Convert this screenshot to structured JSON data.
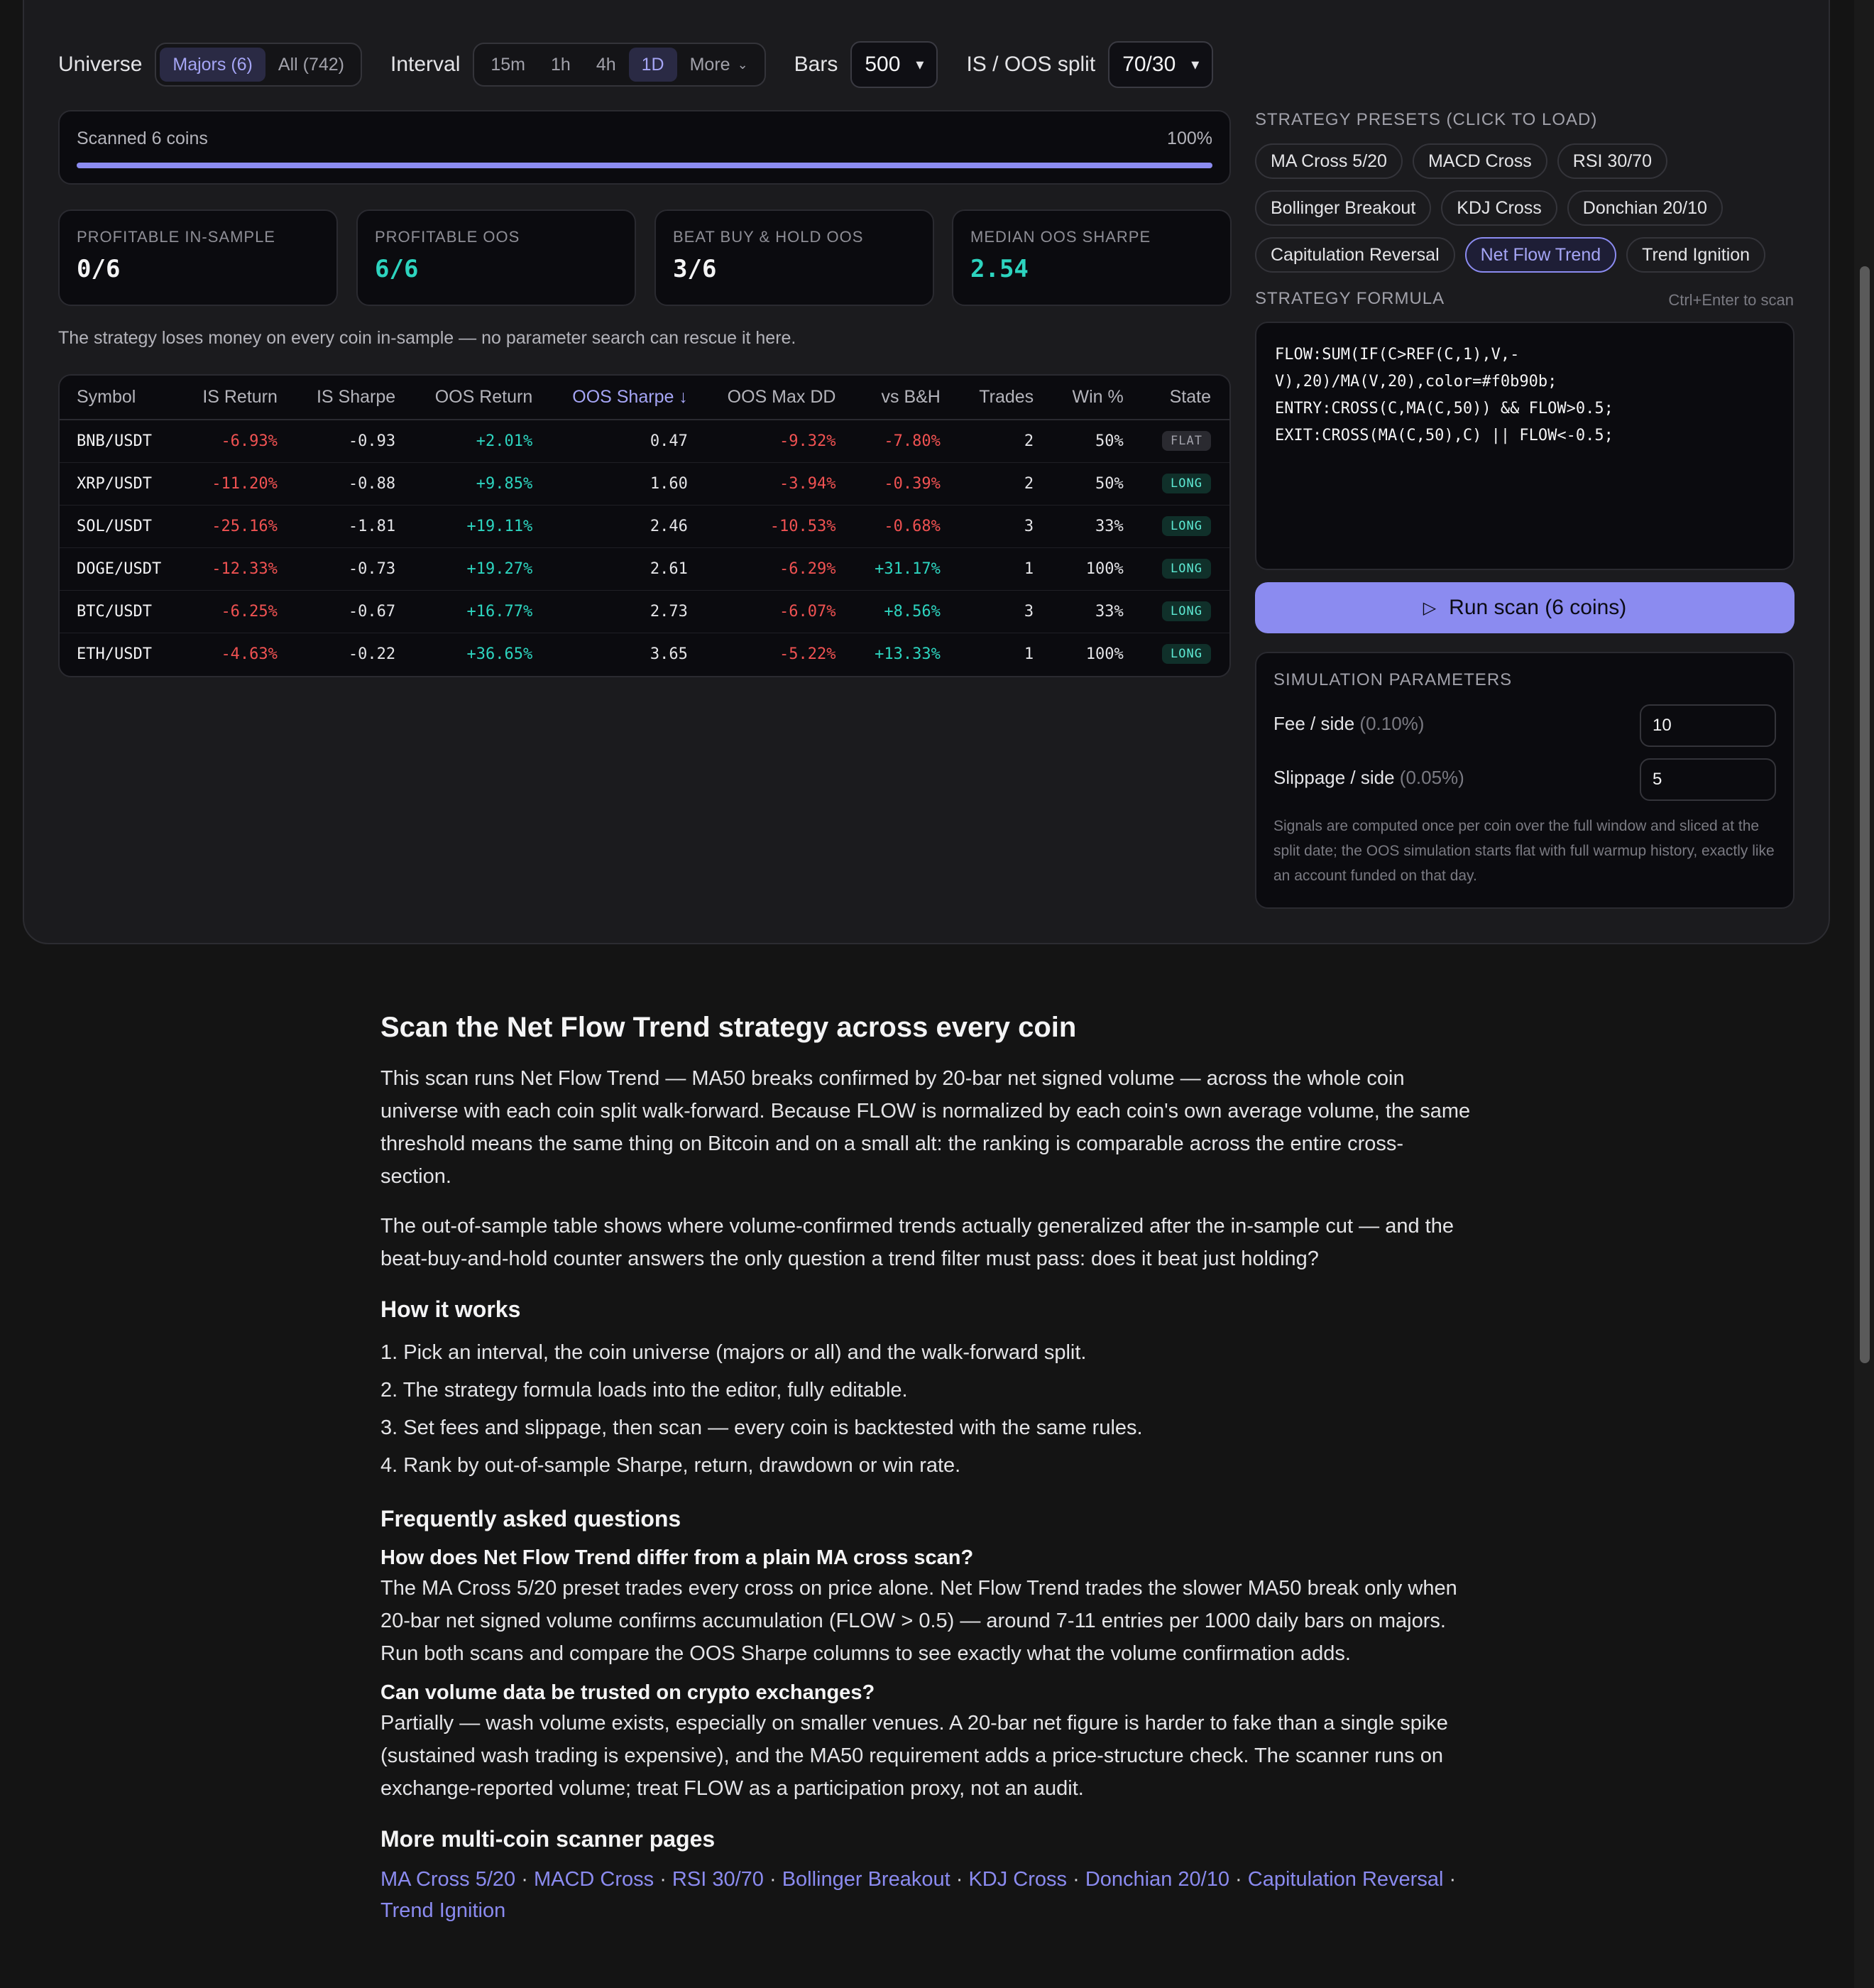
{
  "toolbar": {
    "universe_label": "Universe",
    "universe_options": [
      "Majors (6)",
      "All (742)"
    ],
    "interval_label": "Interval",
    "interval_options": [
      "15m",
      "1h",
      "4h",
      "1D"
    ],
    "interval_more": "More",
    "bars_label": "Bars",
    "bars_value": "500",
    "split_label": "IS / OOS split",
    "split_value": "70/30"
  },
  "progress": {
    "text": "Scanned 6 coins",
    "percent_text": "100%",
    "value": 1.0
  },
  "stats": [
    {
      "label": "PROFITABLE IN-SAMPLE",
      "value": "0/6"
    },
    {
      "label": "PROFITABLE OOS",
      "value": "6/6"
    },
    {
      "label": "BEAT BUY & HOLD OOS",
      "value": "3/6"
    },
    {
      "label": "MEDIAN OOS SHARPE",
      "value": "2.54"
    }
  ],
  "note": "The strategy loses money on every coin in-sample — no parameter search can rescue it here.",
  "table": {
    "headers": [
      "Symbol",
      "IS Return",
      "IS Sharpe",
      "OOS Return",
      "OOS Sharpe ↓",
      "OOS Max DD",
      "vs B&H",
      "Trades",
      "Win %",
      "State"
    ],
    "rows": [
      [
        "BNB/USDT",
        "-6.93%",
        "-0.93",
        "+2.01%",
        "0.47",
        "-9.32%",
        "-7.80%",
        "2",
        "50%",
        "FLAT"
      ],
      [
        "XRP/USDT",
        "-11.20%",
        "-0.88",
        "+9.85%",
        "1.60",
        "-3.94%",
        "-0.39%",
        "2",
        "50%",
        "LONG"
      ],
      [
        "SOL/USDT",
        "-25.16%",
        "-1.81",
        "+19.11%",
        "2.46",
        "-10.53%",
        "-0.68%",
        "3",
        "33%",
        "LONG"
      ],
      [
        "DOGE/USDT",
        "-12.33%",
        "-0.73",
        "+19.27%",
        "2.61",
        "-6.29%",
        "+31.17%",
        "1",
        "100%",
        "LONG"
      ],
      [
        "BTC/USDT",
        "-6.25%",
        "-0.67",
        "+16.77%",
        "2.73",
        "-6.07%",
        "+8.56%",
        "3",
        "33%",
        "LONG"
      ],
      [
        "ETH/USDT",
        "-4.63%",
        "-0.22",
        "+36.65%",
        "3.65",
        "-5.22%",
        "+13.33%",
        "1",
        "100%",
        "LONG"
      ]
    ]
  },
  "presets": {
    "title": "STRATEGY PRESETS (CLICK TO LOAD)",
    "rows": [
      [
        "MA Cross 5/20",
        "MACD Cross",
        "RSI 30/70"
      ],
      [
        "Bollinger Breakout",
        "KDJ Cross",
        "Donchian 20/10"
      ],
      [
        "Capitulation Reversal",
        "Net Flow Trend",
        "Trend Ignition"
      ]
    ],
    "active": "Net Flow Trend"
  },
  "formula": {
    "title": "STRATEGY FORMULA",
    "hint": "Ctrl+Enter to scan",
    "lines": [
      "FLOW:SUM(IF(C>REF(C,1),V,-",
      "V),20)/MA(V,20),color=#f0b90b;",
      "ENTRY:CROSS(C,MA(C,50)) && FLOW>0.5;",
      "EXIT:CROSS(MA(C,50),C) || FLOW<-0.5;"
    ]
  },
  "run_button": "Run scan (6 coins)",
  "simulation": {
    "title": "SIMULATION PARAMETERS",
    "fee_label": "Fee / side",
    "fee_hint": "(0.10%)",
    "fee_value": "10",
    "slip_label": "Slippage / side",
    "slip_hint": "(0.05%)",
    "slip_value": "5",
    "desc": "Signals are computed once per coin over the full window and sliced at the split date; the OOS simulation starts flat with full warmup history, exactly like an account funded on that day."
  },
  "article": {
    "title": "Scan the Net Flow Trend strategy across every coin",
    "p1": "This scan runs Net Flow Trend — MA50 breaks confirmed by 20-bar net signed volume — across the whole coin universe with each coin split walk-forward. Because FLOW is normalized by each coin's own average volume, the same threshold means the same thing on Bitcoin and on a small alt: the ranking is comparable across the entire cross-section.",
    "p2": "The out-of-sample table shows where volume-confirmed trends actually generalized after the in-sample cut — and the beat-buy-and-hold counter answers the only question a trend filter must pass: does it beat just holding?",
    "how_title": "How it works",
    "steps": [
      "1. Pick an interval, the coin universe (majors or all) and the walk-forward split.",
      "2. The strategy formula loads into the editor, fully editable.",
      "3. Set fees and slippage, then scan — every coin is backtested with the same rules.",
      "4. Rank by out-of-sample Sharpe, return, drawdown or win rate."
    ],
    "faq_title": "Frequently asked questions",
    "faq": [
      {
        "q": "How does Net Flow Trend differ from a plain MA cross scan?",
        "a": "The MA Cross 5/20 preset trades every cross on price alone. Net Flow Trend trades the slower MA50 break only when 20-bar net signed volume confirms accumulation (FLOW > 0.5) — around 7-11 entries per 1000 daily bars on majors. Run both scans and compare the OOS Sharpe columns to see exactly what the volume confirmation adds."
      },
      {
        "q": "Can volume data be trusted on crypto exchanges?",
        "a": "Partially — wash volume exists, especially on smaller venues. A 20-bar net figure is harder to fake than a single spike (sustained wash trading is expensive), and the MA50 requirement adds a price-structure check. The scanner runs on exchange-reported volume; treat FLOW as a participation proxy, not an audit."
      }
    ],
    "more_title": "More multi-coin scanner pages",
    "more_links": [
      "MA Cross 5/20",
      "MACD Cross",
      "RSI 30/70",
      "Bollinger Breakout",
      "KDJ Cross",
      "Donchian 20/10",
      "Capitulation Reversal",
      "Trend Ignition"
    ],
    "separator": " · "
  },
  "icons": {
    "chevron": "chevron-down-icon",
    "play": "play-icon",
    "sort": "arrow-down-icon"
  },
  "colors": {
    "accent": "#8b8bf0",
    "positive": "#2dd4bf",
    "negative": "#f05252"
  }
}
